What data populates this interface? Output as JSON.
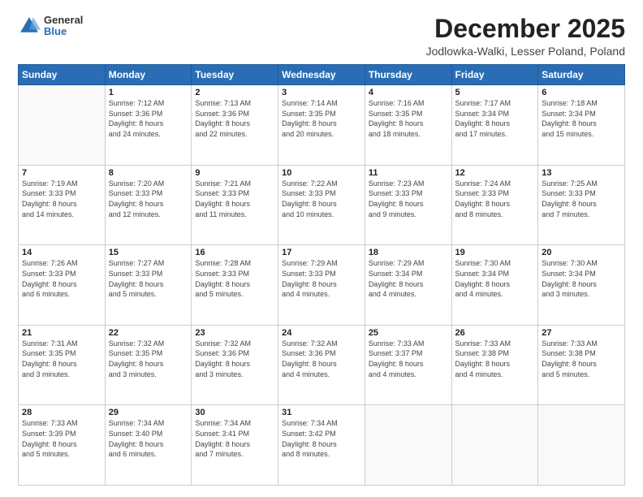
{
  "header": {
    "logo": {
      "general": "General",
      "blue": "Blue"
    },
    "title": "December 2025",
    "location": "Jodlowka-Walki, Lesser Poland, Poland"
  },
  "calendar": {
    "days_of_week": [
      "Sunday",
      "Monday",
      "Tuesday",
      "Wednesday",
      "Thursday",
      "Friday",
      "Saturday"
    ],
    "weeks": [
      [
        {
          "day": "",
          "info": ""
        },
        {
          "day": "1",
          "info": "Sunrise: 7:12 AM\nSunset: 3:36 PM\nDaylight: 8 hours\nand 24 minutes."
        },
        {
          "day": "2",
          "info": "Sunrise: 7:13 AM\nSunset: 3:36 PM\nDaylight: 8 hours\nand 22 minutes."
        },
        {
          "day": "3",
          "info": "Sunrise: 7:14 AM\nSunset: 3:35 PM\nDaylight: 8 hours\nand 20 minutes."
        },
        {
          "day": "4",
          "info": "Sunrise: 7:16 AM\nSunset: 3:35 PM\nDaylight: 8 hours\nand 18 minutes."
        },
        {
          "day": "5",
          "info": "Sunrise: 7:17 AM\nSunset: 3:34 PM\nDaylight: 8 hours\nand 17 minutes."
        },
        {
          "day": "6",
          "info": "Sunrise: 7:18 AM\nSunset: 3:34 PM\nDaylight: 8 hours\nand 15 minutes."
        }
      ],
      [
        {
          "day": "7",
          "info": "Sunrise: 7:19 AM\nSunset: 3:33 PM\nDaylight: 8 hours\nand 14 minutes."
        },
        {
          "day": "8",
          "info": "Sunrise: 7:20 AM\nSunset: 3:33 PM\nDaylight: 8 hours\nand 12 minutes."
        },
        {
          "day": "9",
          "info": "Sunrise: 7:21 AM\nSunset: 3:33 PM\nDaylight: 8 hours\nand 11 minutes."
        },
        {
          "day": "10",
          "info": "Sunrise: 7:22 AM\nSunset: 3:33 PM\nDaylight: 8 hours\nand 10 minutes."
        },
        {
          "day": "11",
          "info": "Sunrise: 7:23 AM\nSunset: 3:33 PM\nDaylight: 8 hours\nand 9 minutes."
        },
        {
          "day": "12",
          "info": "Sunrise: 7:24 AM\nSunset: 3:33 PM\nDaylight: 8 hours\nand 8 minutes."
        },
        {
          "day": "13",
          "info": "Sunrise: 7:25 AM\nSunset: 3:33 PM\nDaylight: 8 hours\nand 7 minutes."
        }
      ],
      [
        {
          "day": "14",
          "info": "Sunrise: 7:26 AM\nSunset: 3:33 PM\nDaylight: 8 hours\nand 6 minutes."
        },
        {
          "day": "15",
          "info": "Sunrise: 7:27 AM\nSunset: 3:33 PM\nDaylight: 8 hours\nand 5 minutes."
        },
        {
          "day": "16",
          "info": "Sunrise: 7:28 AM\nSunset: 3:33 PM\nDaylight: 8 hours\nand 5 minutes."
        },
        {
          "day": "17",
          "info": "Sunrise: 7:29 AM\nSunset: 3:33 PM\nDaylight: 8 hours\nand 4 minutes."
        },
        {
          "day": "18",
          "info": "Sunrise: 7:29 AM\nSunset: 3:34 PM\nDaylight: 8 hours\nand 4 minutes."
        },
        {
          "day": "19",
          "info": "Sunrise: 7:30 AM\nSunset: 3:34 PM\nDaylight: 8 hours\nand 4 minutes."
        },
        {
          "day": "20",
          "info": "Sunrise: 7:30 AM\nSunset: 3:34 PM\nDaylight: 8 hours\nand 3 minutes."
        }
      ],
      [
        {
          "day": "21",
          "info": "Sunrise: 7:31 AM\nSunset: 3:35 PM\nDaylight: 8 hours\nand 3 minutes."
        },
        {
          "day": "22",
          "info": "Sunrise: 7:32 AM\nSunset: 3:35 PM\nDaylight: 8 hours\nand 3 minutes."
        },
        {
          "day": "23",
          "info": "Sunrise: 7:32 AM\nSunset: 3:36 PM\nDaylight: 8 hours\nand 3 minutes."
        },
        {
          "day": "24",
          "info": "Sunrise: 7:32 AM\nSunset: 3:36 PM\nDaylight: 8 hours\nand 4 minutes."
        },
        {
          "day": "25",
          "info": "Sunrise: 7:33 AM\nSunset: 3:37 PM\nDaylight: 8 hours\nand 4 minutes."
        },
        {
          "day": "26",
          "info": "Sunrise: 7:33 AM\nSunset: 3:38 PM\nDaylight: 8 hours\nand 4 minutes."
        },
        {
          "day": "27",
          "info": "Sunrise: 7:33 AM\nSunset: 3:38 PM\nDaylight: 8 hours\nand 5 minutes."
        }
      ],
      [
        {
          "day": "28",
          "info": "Sunrise: 7:33 AM\nSunset: 3:39 PM\nDaylight: 8 hours\nand 5 minutes."
        },
        {
          "day": "29",
          "info": "Sunrise: 7:34 AM\nSunset: 3:40 PM\nDaylight: 8 hours\nand 6 minutes."
        },
        {
          "day": "30",
          "info": "Sunrise: 7:34 AM\nSunset: 3:41 PM\nDaylight: 8 hours\nand 7 minutes."
        },
        {
          "day": "31",
          "info": "Sunrise: 7:34 AM\nSunset: 3:42 PM\nDaylight: 8 hours\nand 8 minutes."
        },
        {
          "day": "",
          "info": ""
        },
        {
          "day": "",
          "info": ""
        },
        {
          "day": "",
          "info": ""
        }
      ]
    ]
  }
}
